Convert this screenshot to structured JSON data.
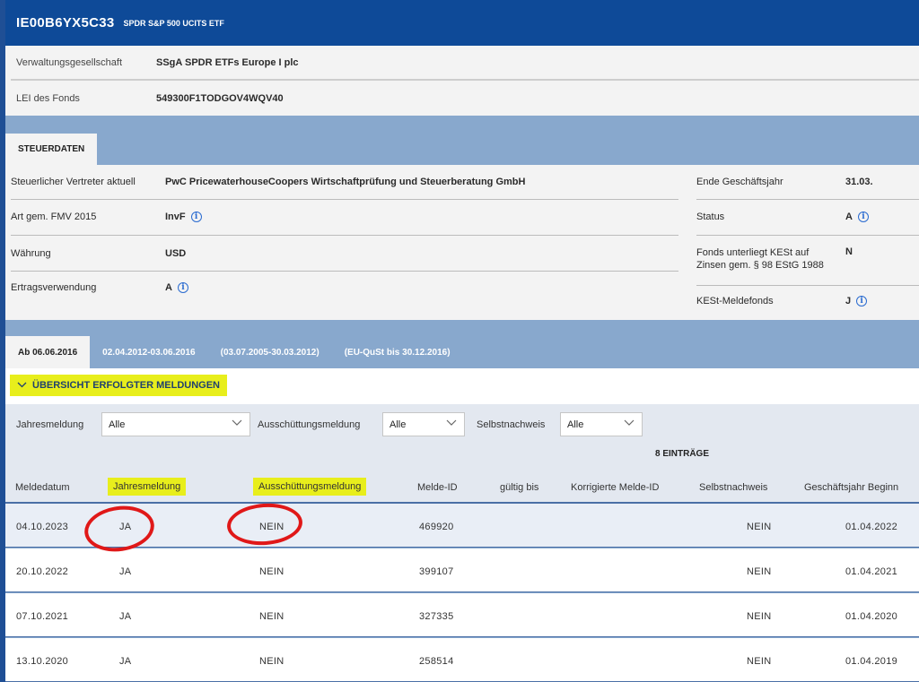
{
  "header": {
    "isin": "IE00B6YX5C33",
    "name": "SPDR S&P 500 UCITS ETF"
  },
  "fund_info": [
    {
      "label": "Verwaltungsgesellschaft",
      "value": "SSgA SPDR ETFs Europe I plc"
    },
    {
      "label": "LEI des Fonds",
      "value": "549300F1TODGOV4WQV40"
    }
  ],
  "steuer": {
    "tab_label": "STEUERDATEN",
    "left": [
      {
        "label": "Steuerlicher Vertreter aktuell",
        "value": "PwC PricewaterhouseCoopers Wirtschaftprüfung und Steuerberatung GmbH",
        "info": false
      },
      {
        "label": "Art gem. FMV 2015",
        "value": "InvF",
        "info": true
      },
      {
        "label": "Währung",
        "value": "USD",
        "info": false
      },
      {
        "label": "Ertragsverwendung",
        "value": "A",
        "info": true
      }
    ],
    "right": [
      {
        "label": "Ende Geschäftsjahr",
        "value": "31.03.",
        "info": false
      },
      {
        "label": "Status",
        "value": "A",
        "info": true
      },
      {
        "label": "Fonds unterliegt KESt auf Zinsen gem. § 98 EStG 1988",
        "value": "N",
        "info": false
      },
      {
        "label": "KESt-Meldefonds",
        "value": "J",
        "info": true
      }
    ]
  },
  "period_tabs": [
    {
      "label": "Ab 06.06.2016",
      "active": true
    },
    {
      "label": "02.04.2012-03.06.2016",
      "active": false
    },
    {
      "label": "(03.07.2005-30.03.2012)",
      "active": false
    },
    {
      "label": "(EU-QuSt bis 30.12.2016)",
      "active": false
    }
  ],
  "section_toggle": "ÜBERSICHT ERFOLGTER MELDUNGEN",
  "filters": {
    "jahresmeldung_label": "Jahresmeldung",
    "jahresmeldung_value": "Alle",
    "ausschuettung_label": "Ausschüttungsmeldung",
    "ausschuettung_value": "Alle",
    "selbstnachweis_label": "Selbstnachweis",
    "selbstnachweis_value": "Alle",
    "count": "8 EINTRÄGE"
  },
  "table": {
    "headers": [
      "Meldedatum",
      "Jahresmeldung",
      "Ausschüttungsmeldung",
      "Melde-ID",
      "gültig bis",
      "Korrigierte Melde-ID",
      "Selbstnachweis",
      "Geschäftsjahr Beginn"
    ],
    "rows": [
      [
        "04.10.2023",
        "JA",
        "NEIN",
        "469920",
        "",
        "",
        "NEIN",
        "01.04.2022"
      ],
      [
        "20.10.2022",
        "JA",
        "NEIN",
        "399107",
        "",
        "",
        "NEIN",
        "01.04.2021"
      ],
      [
        "07.10.2021",
        "JA",
        "NEIN",
        "327335",
        "",
        "",
        "NEIN",
        "01.04.2020"
      ],
      [
        "13.10.2020",
        "JA",
        "NEIN",
        "258514",
        "",
        "",
        "NEIN",
        "01.04.2019"
      ]
    ]
  },
  "colors": {
    "header_blue": "#0e4a98",
    "highlight_yellow": "#e8ee1c",
    "annotation_red": "#e01818"
  }
}
